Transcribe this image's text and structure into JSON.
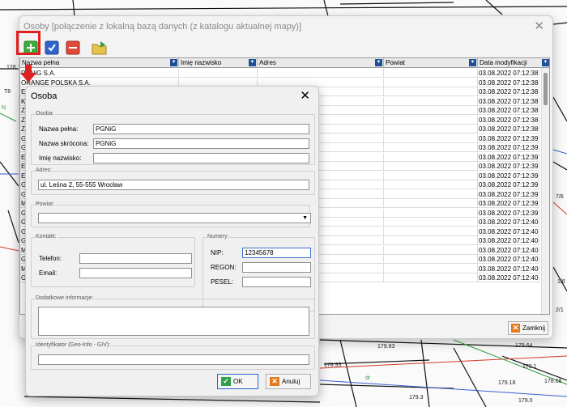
{
  "map": {
    "labels": [
      "128.71",
      "N",
      "dr",
      "179.83",
      "179.64",
      "179.18",
      "179.3",
      "179.0",
      "178.95",
      "179.1",
      "7/6",
      "178.68",
      "1/6",
      "2/1",
      "T8"
    ]
  },
  "osoby_window": {
    "title": "Osoby [połączenie z lokalną bazą danych (z katalogu aktualnej mapy)]",
    "close_icon": "close-icon",
    "toolbar": {
      "add_icon": "add-icon",
      "accept_icon": "check-icon",
      "delete_icon": "delete-icon",
      "folder_icon": "folder-refresh-icon"
    },
    "columns": [
      "Nazwa pełna",
      "Imię nazwisko",
      "Adres",
      "Powiat",
      "Data modyfikacji"
    ],
    "rows": [
      {
        "name": "PGNiG S.A.",
        "date": "03.08.2022 07:12:38"
      },
      {
        "name": "ORANGE POLSKA S.A.",
        "date": "03.08.2022 07:12:38"
      },
      {
        "name": "E",
        "date": "03.08.2022 07:12:38"
      },
      {
        "name": "K",
        "date": "03.08.2022 07:12:38"
      },
      {
        "name": "Z",
        "date": "03.08.2022 07:12:38"
      },
      {
        "name": "Z",
        "date": "03.08.2022 07:12:38"
      },
      {
        "name": "Z",
        "date": "03.08.2022 07:12:38"
      },
      {
        "name": "G",
        "date": "03.08.2022 07:12:39"
      },
      {
        "name": "G",
        "date": "03.08.2022 07:12:39"
      },
      {
        "name": "E",
        "date": "03.08.2022 07:12:39"
      },
      {
        "name": "E",
        "date": "03.08.2022 07:12:39"
      },
      {
        "name": "E",
        "date": "03.08.2022 07:12:39"
      },
      {
        "name": "G",
        "date": "03.08.2022 07:12:39"
      },
      {
        "name": "G",
        "date": "03.08.2022 07:12:39"
      },
      {
        "name": "M",
        "date": "03.08.2022 07:12:39"
      },
      {
        "name": "G",
        "date": "03.08.2022 07:12:39"
      },
      {
        "name": "G",
        "date": "03.08.2022 07:12:40"
      },
      {
        "name": "G",
        "date": "03.08.2022 07:12:40"
      },
      {
        "name": "G",
        "date": "03.08.2022 07:12:40"
      },
      {
        "name": "M",
        "date": "03.08.2022 07:12:40"
      },
      {
        "name": "G",
        "date": "03.08.2022 07:12:40"
      },
      {
        "name": "M",
        "date": "03.08.2022 07:12:40"
      },
      {
        "name": "G",
        "date": "03.08.2022 07:12:40"
      }
    ],
    "close_button": "Zamknij"
  },
  "dialog": {
    "title": "Osoba",
    "group_osoba": "Osoba:",
    "nazwa_pelna_label": "Nazwa pełna:",
    "nazwa_pelna_value": "PGNiG",
    "nazwa_skrocona_label": "Nazwa skrócona:",
    "nazwa_skrocona_value": "PGNiG",
    "imie_label": "Imię nazwisko:",
    "imie_value": "",
    "group_adres": "Adres:",
    "adres_value": "ul. Leśna 2, 55-555 Wrocław",
    "group_powiat": "Powiat:",
    "powiat_value": "",
    "group_kontakt": "Kontakt:",
    "telefon_label": "Telefon:",
    "telefon_value": "",
    "email_label": "Email:",
    "email_value": "",
    "group_numery": "Numery:",
    "nip_label": "NIP:",
    "nip_value": "12345678",
    "regon_label": "REGON:",
    "regon_value": "",
    "pesel_label": "PESEL:",
    "pesel_value": "",
    "group_dodatkowe": "Dodatkowe informacje:",
    "dodatkowe_value": "",
    "group_identyfikator": "Identyfikator (Geo-Info - GIV):",
    "identyfikator_value": "",
    "ok_label": "OK",
    "anuluj_label": "Anuluj"
  },
  "colors": {
    "highlight": "#e02020",
    "accent": "#3b6fc9"
  }
}
